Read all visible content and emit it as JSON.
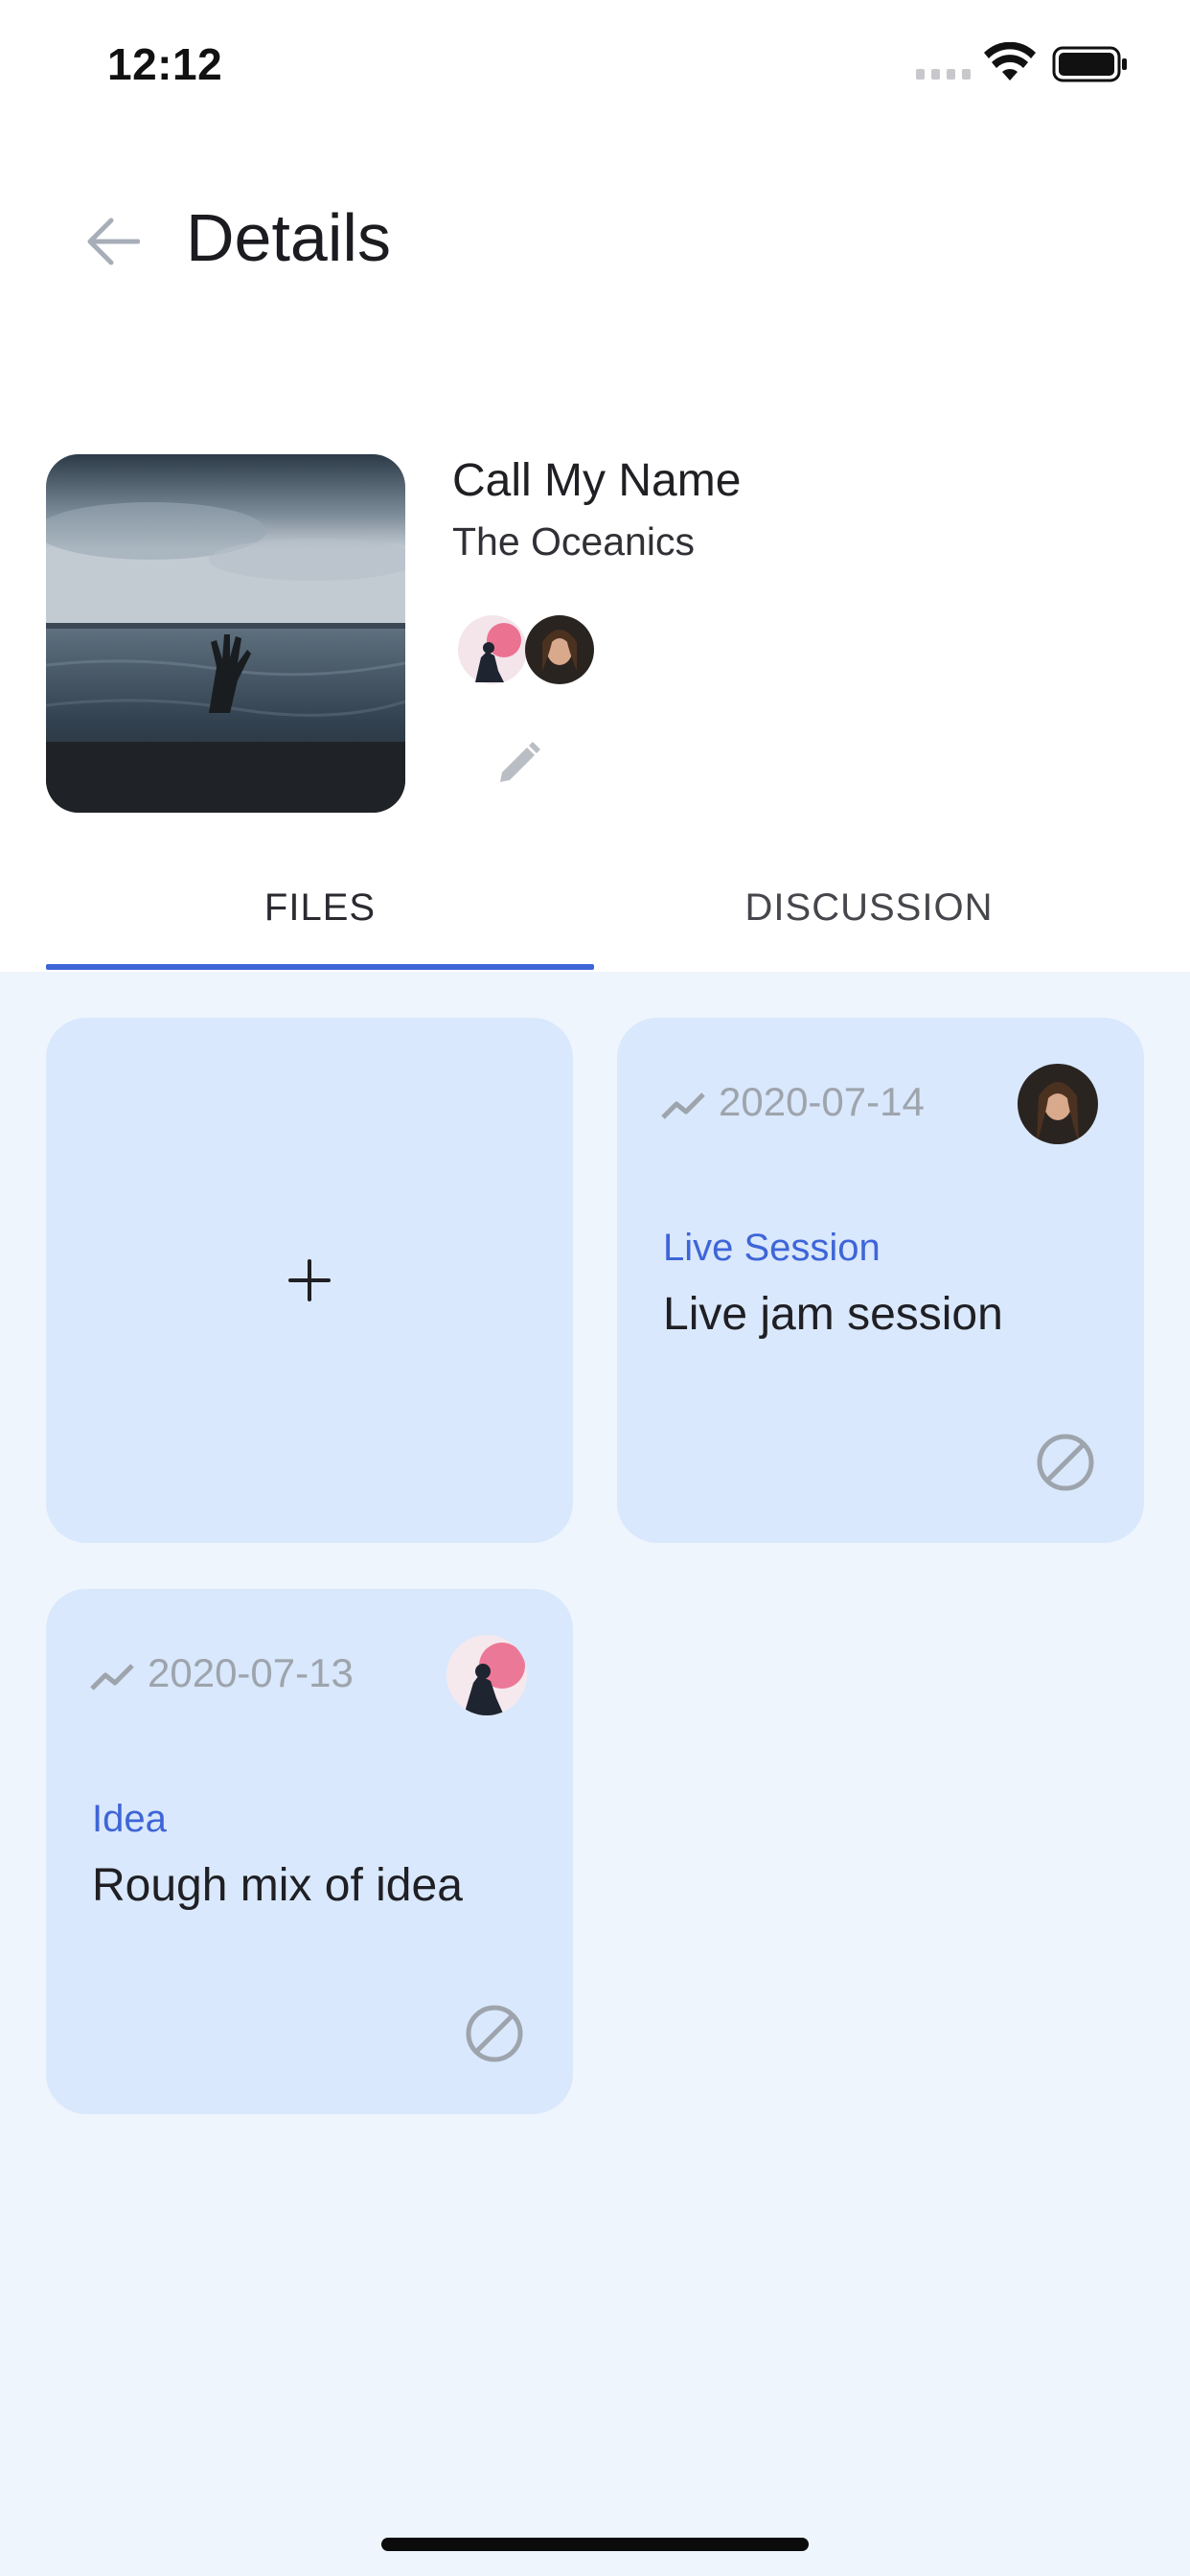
{
  "status_bar": {
    "time": "12:12"
  },
  "header": {
    "title": "Details"
  },
  "song": {
    "title": "Call My Name",
    "artist": "The Oceanics"
  },
  "tabs": [
    {
      "label": "FILES",
      "selected": true
    },
    {
      "label": "DISCUSSION",
      "selected": false
    }
  ],
  "files": [
    {
      "date": "2020-07-14",
      "type": "Live Session",
      "description": "Live jam session",
      "avatar": "woman-portrait"
    },
    {
      "date": "2020-07-13",
      "type": "Idea",
      "description": "Rough mix of idea",
      "avatar": "smoke-flare-person"
    }
  ],
  "colors": {
    "accent": "#3e65d8",
    "card": "#d9e8fc",
    "content_bg": "#eef5fd"
  },
  "icons": [
    "back-arrow-icon",
    "edit-pencil-icon",
    "plus-icon",
    "trend-icon",
    "block-icon"
  ]
}
